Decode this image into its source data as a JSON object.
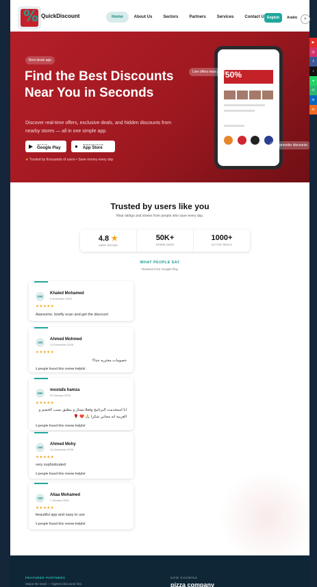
{
  "header": {
    "brand": "QuickDiscount",
    "nav": [
      "Home",
      "About Us",
      "Sectors",
      "Partners",
      "Services",
      "Contact Us"
    ],
    "lang_en": "English",
    "lang_ar": "Arabic"
  },
  "hero": {
    "badge": "Best deals app",
    "title": "Find the Best Discounts Near You in Seconds",
    "subtitle": "Discover real-time offers, exclusive deals, and hidden discounts from nearby stores — all in one simple app.",
    "google_small": "GET IT ON",
    "google_label": "Google Play",
    "apple_small": "DOWNLOAD ON THE",
    "apple_label": "App Store",
    "trust": "Trusted by thousands of users • Save money every day",
    "bubble_live": "Live offers near you",
    "bubble_exclusive": "sive provider discounts",
    "phone_banner": "50%"
  },
  "trust_section": {
    "title": "Trusted by users like you",
    "subtitle": "Real ratings and stories from people who save every day.",
    "stats": [
      {
        "value": "4.8",
        "label": "USER RATING"
      },
      {
        "value": "50K+",
        "label": "DOWNLOADS"
      },
      {
        "value": "1000+",
        "label": "ACTIVE DEALS"
      }
    ],
    "what_people_say": "WHAT PEOPLE SAY",
    "reviews_from": "Reviews from Google Play"
  },
  "reviews": [
    {
      "initials": "KM",
      "name": "Khaled Mohamed",
      "date": "6 November 2025",
      "stars": "★★★★★",
      "text": "Awesome, briefly scan and get the discount",
      "helpful": ""
    },
    {
      "initials": "AM",
      "name": "Ahmed Mohmed",
      "date": "23 December 2025",
      "stars": "★★★★★",
      "text": "خصومات مختريه جدا!!",
      "helpful": "2 people found this review helpful"
    },
    {
      "initials": "MH",
      "name": "mostafa hamza",
      "date": "29 January 2026",
      "stars": "★★★★★",
      "text": "انا استخدمت البرنامج وفعلا ممتاز و بيطبق نسب الخصم و الغربية انه مجاني شكرا 🙏 ❤️ 🌹",
      "helpful": "2 people found this review helpful"
    },
    {
      "initials": "AM",
      "name": "Ahmed Mohy",
      "date": "14 December 2025",
      "stars": "★★★★★",
      "text": "very sophisticated",
      "helpful": "2 people found this review helpful"
    },
    {
      "initials": "AM",
      "name": "Aliaa Mohamed",
      "date": "7 January 2026",
      "stars": "★★★★★",
      "text": "beautiful app and easy to use",
      "helpful": "3 people found this review helpful"
    }
  ],
  "footer": {
    "featured": "FEATURED PARTNERS",
    "swipe": "Swipe the stack — highest discounts first.",
    "now_showing": "NOW SHOWING",
    "partner": "pizza company"
  },
  "social_icons": [
    "youtube-icon",
    "instagram-icon",
    "facebook-icon",
    "tiktok-icon",
    "whatsapp-icon",
    "phone-icon",
    "linkedin-icon",
    "email-icon"
  ]
}
